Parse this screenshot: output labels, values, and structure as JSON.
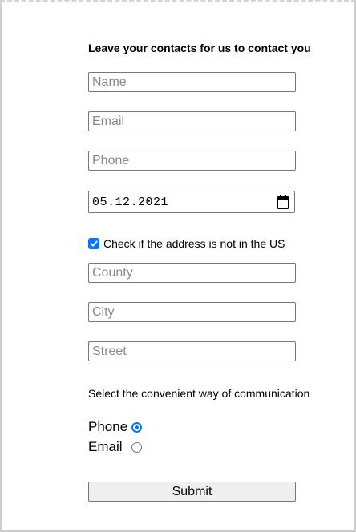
{
  "form": {
    "title": "Leave your contacts for us to contact you",
    "name_placeholder": "Name",
    "email_placeholder": "Email",
    "phone_placeholder": "Phone",
    "date_value": "05.12.2021",
    "not_us_checked": true,
    "not_us_label": "Check if the address is not in the US",
    "county_placeholder": "County",
    "city_placeholder": "City",
    "street_placeholder": "Street",
    "communication_label": "Select the convenient way of communication",
    "options": [
      {
        "label": "Phone",
        "selected": true
      },
      {
        "label": "Email",
        "selected": false
      }
    ],
    "submit_label": "Submit"
  },
  "colors": {
    "accent": "#0075ff",
    "border": "#767676",
    "button_bg": "#efefef"
  },
  "icons": {
    "calendar": "calendar-icon",
    "checkmark": "checkmark-icon"
  }
}
